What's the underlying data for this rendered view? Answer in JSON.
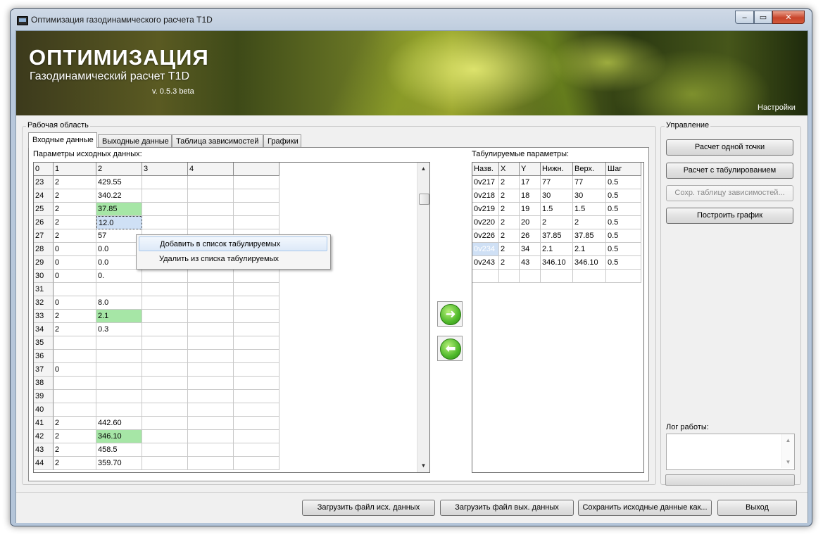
{
  "window": {
    "title": "Оптимизация газодинамического расчета T1D",
    "min": "‒",
    "max": "▭",
    "close": "✕"
  },
  "banner": {
    "title": "ОПТИМИЗАЦИЯ",
    "subtitle": "Газодинамический расчет T1D",
    "version": "v. 0.5.3 beta",
    "settings": "Настройки"
  },
  "workspace": {
    "label": "Рабочая область",
    "tabs": [
      "Входные данные",
      "Выходные данные",
      "Таблица зависимостей",
      "Графики"
    ],
    "input_label": "Параметры исходных данных:",
    "input_grid": {
      "headers": [
        "0",
        "1",
        "2",
        "3",
        "4",
        ""
      ],
      "rows": [
        [
          "23",
          "2",
          "429.55"
        ],
        [
          "24",
          "2",
          "340.22"
        ],
        [
          "25",
          "2",
          "37.85"
        ],
        [
          "26",
          "2",
          "12.0"
        ],
        [
          "27",
          "2",
          "57"
        ],
        [
          "28",
          "0",
          "0.0"
        ],
        [
          "29",
          "0",
          "0.0"
        ],
        [
          "30",
          "0",
          "0."
        ],
        [
          "31",
          "",
          ""
        ],
        [
          "32",
          "0",
          "8.0"
        ],
        [
          "33",
          "2",
          "2.1"
        ],
        [
          "34",
          "2",
          "0.3"
        ],
        [
          "35",
          "",
          ""
        ],
        [
          "36",
          "",
          ""
        ],
        [
          "37",
          "0",
          ""
        ],
        [
          "38",
          "",
          ""
        ],
        [
          "39",
          "",
          ""
        ],
        [
          "40",
          "",
          ""
        ],
        [
          "41",
          "2",
          "442.60"
        ],
        [
          "42",
          "2",
          "346.10"
        ],
        [
          "43",
          "2",
          "458.5"
        ],
        [
          "44",
          "2",
          "359.70"
        ]
      ],
      "highlighted_rows": [
        "25",
        "33",
        "42"
      ],
      "selected_row": "26"
    },
    "tab_label": "Табулируемые параметры:",
    "tab_grid": {
      "headers": [
        "Назв.",
        "X",
        "Y",
        "Нижн.",
        "Верх.",
        "Шаг"
      ],
      "rows": [
        [
          "0v217",
          "2",
          "17",
          "77",
          "77",
          "0.5"
        ],
        [
          "0v218",
          "2",
          "18",
          "30",
          "30",
          "0.5"
        ],
        [
          "0v219",
          "2",
          "19",
          "1.5",
          "1.5",
          "0.5"
        ],
        [
          "0v220",
          "2",
          "20",
          "2",
          "2",
          "0.5"
        ],
        [
          "0v226",
          "2",
          "26",
          "37.85",
          "37.85",
          "0.5"
        ],
        [
          "0v234",
          "2",
          "34",
          "2.1",
          "2.1",
          "0.5"
        ],
        [
          "0v243",
          "2",
          "43",
          "346.10",
          "346.10",
          "0.5"
        ]
      ],
      "selected_name": "0v234"
    },
    "arrow_right": "➜",
    "arrow_left": "⬅"
  },
  "context_menu": {
    "add": "Добавить в список табулируемых",
    "remove": "Удалить из списка табулируемых"
  },
  "control": {
    "label": "Управление",
    "calc_point": "Расчет одной точки",
    "calc_tab": "Расчет с табулированием",
    "save_table": "Сохр. таблицу зависимостей...",
    "plot": "Построить график",
    "log_label": "Лог работы:"
  },
  "bottom": {
    "load_input": "Загрузить файл исх. данных",
    "load_output": "Загрузить файл вых. данных",
    "save_input": "Сохранить исходные данные как...",
    "exit": "Выход"
  },
  "colors": {
    "highlight_green": "#a6e6a6",
    "selection_blue": "#cfe0f5"
  }
}
